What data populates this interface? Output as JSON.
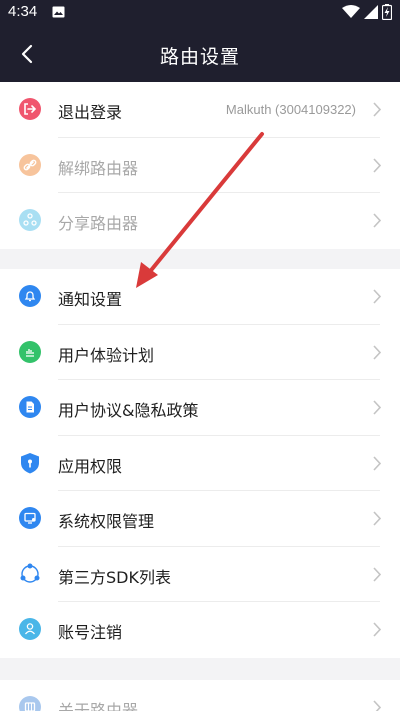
{
  "status_bar": {
    "time": "4:34",
    "icons": [
      "image-icon",
      "wifi-icon",
      "signal-icon",
      "battery-charging-icon"
    ]
  },
  "app_bar": {
    "title": "路由设置",
    "back_icon": "back-arrow-icon"
  },
  "groups": [
    {
      "items": [
        {
          "label": "退出登录",
          "value": "Malkuth (3004109322)",
          "icon": "logout-icon",
          "icon_color": "#f0566e",
          "disabled": false
        },
        {
          "label": "解绑路由器",
          "value": "",
          "icon": "link-icon",
          "icon_color": "#f7c49c",
          "disabled": true
        },
        {
          "label": "分享路由器",
          "value": "",
          "icon": "share-icon",
          "icon_color": "#a9dff3",
          "disabled": true
        }
      ]
    },
    {
      "items": [
        {
          "label": "通知设置",
          "icon": "bell-icon",
          "icon_color": "#2f87f0"
        },
        {
          "label": "用户体验计划",
          "icon": "chart-icon",
          "icon_color": "#33c26a"
        },
        {
          "label": "用户协议&隐私政策",
          "icon": "document-icon",
          "icon_color": "#2f87f0"
        },
        {
          "label": "应用权限",
          "icon": "shield-icon",
          "icon_color": "#2f87f0"
        },
        {
          "label": "系统权限管理",
          "icon": "monitor-icon",
          "icon_color": "#2f87f0"
        },
        {
          "label": "第三方SDK列表",
          "icon": "share-nodes-icon",
          "icon_color": "#2f87f0"
        },
        {
          "label": "账号注销",
          "icon": "user-icon",
          "icon_color": "#4ab6e8"
        }
      ]
    },
    {
      "items": [
        {
          "label": "关于路由器",
          "icon": "router-icon",
          "icon_color": "#a9c8ee",
          "disabled": true
        }
      ]
    }
  ],
  "annotation": {
    "arrow_color": "#d93a3a"
  }
}
